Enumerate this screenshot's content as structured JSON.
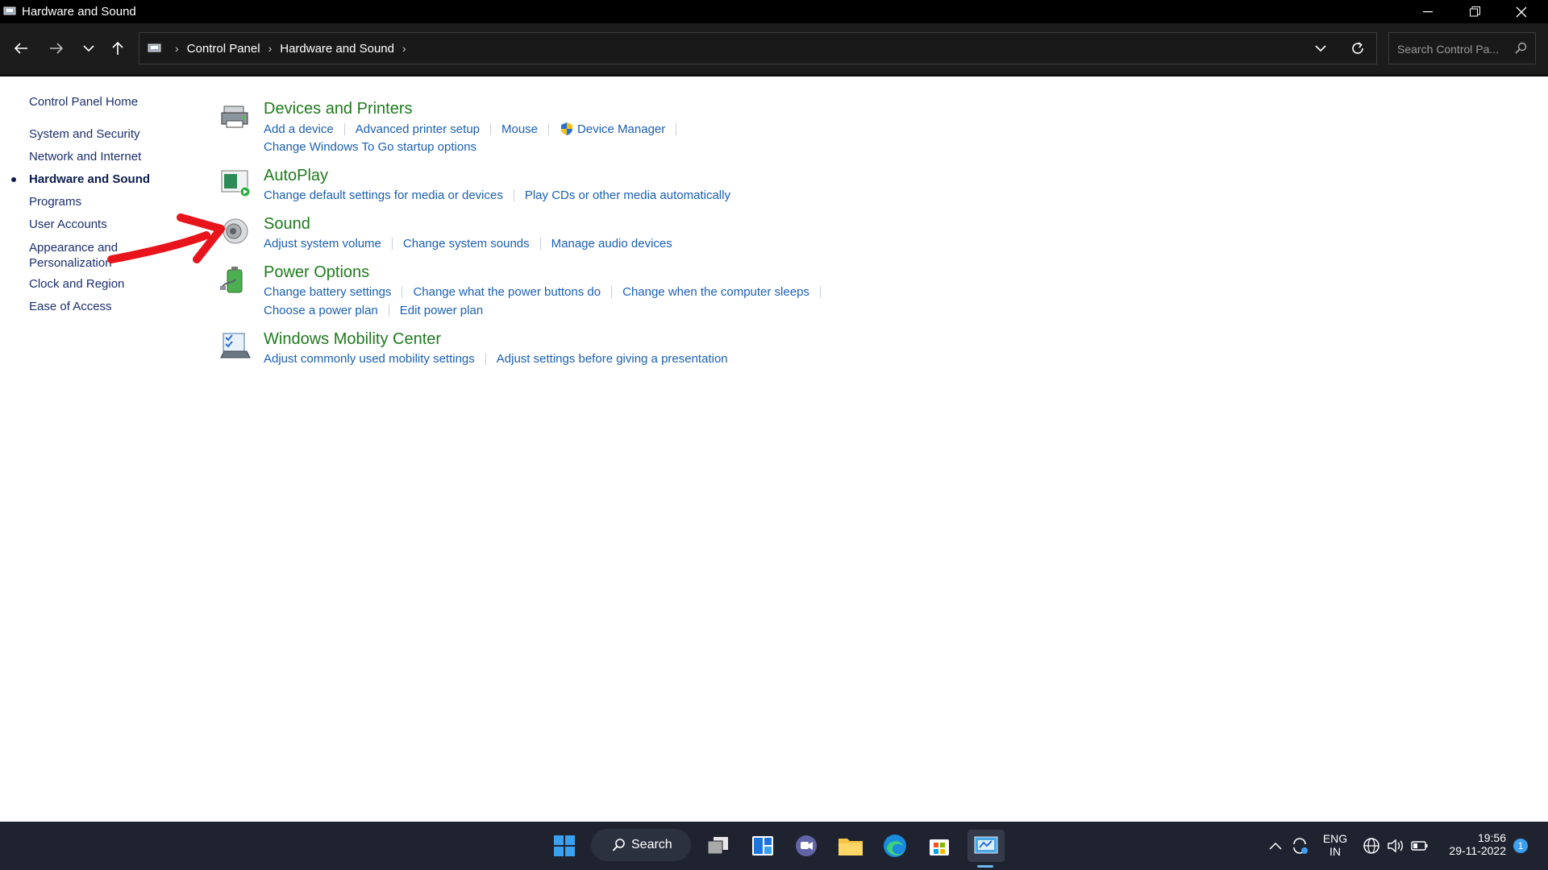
{
  "window": {
    "title": "Hardware and Sound"
  },
  "address_bar": {
    "crumbs": [
      "Control Panel",
      "Hardware and Sound"
    ]
  },
  "search": {
    "placeholder": "Search Control Pa..."
  },
  "left_nav": {
    "home": "Control Panel Home",
    "items": [
      {
        "label": "System and Security",
        "active": false
      },
      {
        "label": "Network and Internet",
        "active": false
      },
      {
        "label": "Hardware and Sound",
        "active": true
      },
      {
        "label": "Programs",
        "active": false
      },
      {
        "label": "User Accounts",
        "active": false
      },
      {
        "label": "Appearance and",
        "label2": "Personalization",
        "active": false
      },
      {
        "label": "Clock and Region",
        "active": false
      },
      {
        "label": "Ease of Access",
        "active": false
      }
    ]
  },
  "categories": {
    "devices": {
      "title": "Devices and Printers",
      "links": [
        "Add a device",
        "Advanced printer setup",
        "Mouse",
        "Device Manager"
      ],
      "links2": [
        "Change Windows To Go startup options"
      ]
    },
    "autoplay": {
      "title": "AutoPlay",
      "links": [
        "Change default settings for media or devices",
        "Play CDs or other media automatically"
      ]
    },
    "sound": {
      "title": "Sound",
      "links": [
        "Adjust system volume",
        "Change system sounds",
        "Manage audio devices"
      ]
    },
    "power": {
      "title": "Power Options",
      "links": [
        "Change battery settings",
        "Change what the power buttons do",
        "Change when the computer sleeps"
      ],
      "links2": [
        "Choose a power plan",
        "Edit power plan"
      ]
    },
    "mobility": {
      "title": "Windows Mobility Center",
      "links": [
        "Adjust commonly used mobility settings",
        "Adjust settings before giving a presentation"
      ]
    }
  },
  "taskbar": {
    "search_label": "Search",
    "lang_top": "ENG",
    "lang_bottom": "IN",
    "time": "19:56",
    "date": "29-11-2022",
    "notification_count": "1"
  },
  "colors": {
    "category_title": "#1e7b1e",
    "link": "#1a5fb4",
    "annotation_arrow": "#e8141b"
  }
}
